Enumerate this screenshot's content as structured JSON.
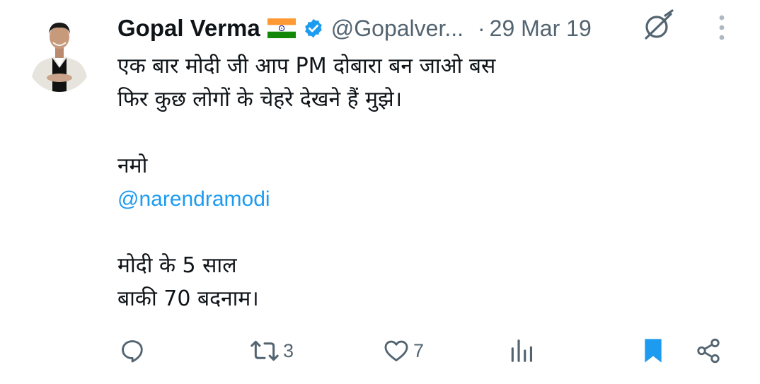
{
  "tweet": {
    "author_name": "Gopal Verma",
    "flag_icon": "india-flag-icon",
    "verified_icon": "verified-badge-icon",
    "handle": "@Gopalver...",
    "separator": "·",
    "date": "29 Mar 19",
    "body_lines": [
      "एक बार मोदी जी आप PM दोबारा बन जाओ बस",
      "फिर कुछ लोगों के चेहरे देखने हैं मुझे।",
      "",
      "नमो",
      "@narendramodi",
      "",
      "मोदी के 5 साल",
      "बाकी 70 बदनाम।"
    ],
    "actions": {
      "reply_count": "",
      "retweet_count": "3",
      "like_count": "7",
      "views_count": ""
    }
  },
  "colors": {
    "text": "#0f1419",
    "secondary": "#536471",
    "link": "#1d9bf0",
    "bookmark_active": "#1d9bf0",
    "verified": "#1d9bf0"
  }
}
